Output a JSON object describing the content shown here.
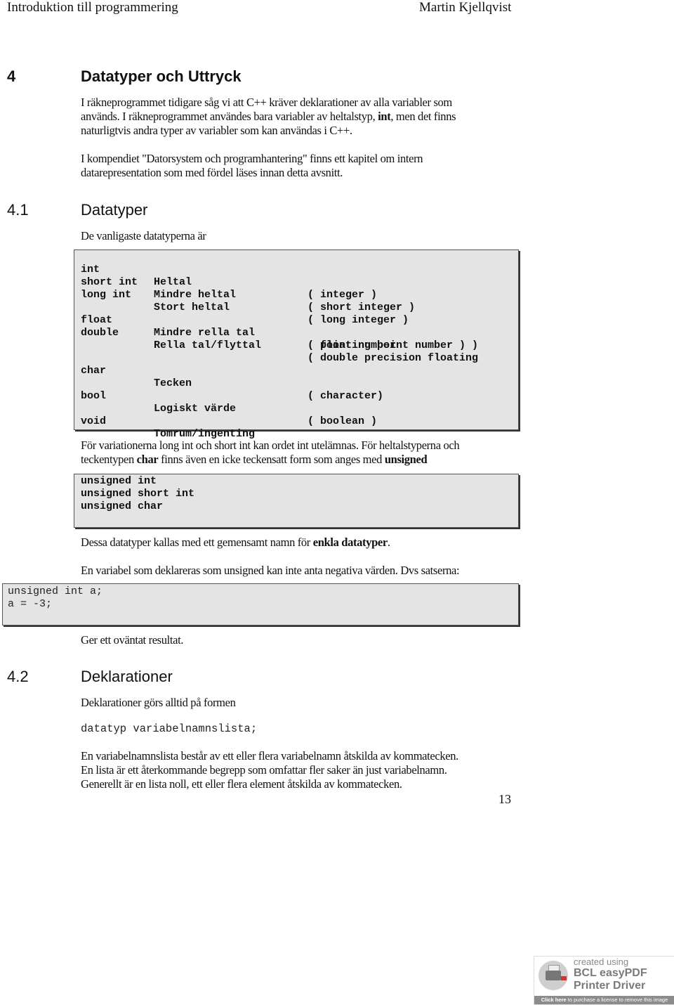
{
  "header": {
    "left": "Introduktion till programmering",
    "right": "Martin Kjellqvist"
  },
  "chapter": {
    "number": "4",
    "title": "Datatyper och Uttryck",
    "intro_lines": [
      [
        "I räkneprogrammet tidigare såg vi att C++ kräver deklarationer av alla variabler som"
      ],
      [
        "används. I räkneprogrammet användes bara  variabler av heltalstyp, ",
        "int",
        ", men det finns"
      ],
      [
        "naturligtvis andra typer av variabler som kan användas i C++."
      ]
    ],
    "note_lines": [
      "I kompendiet \"Datorsystem och programhantering\" finns ett kapitel om intern",
      "datarepresentation som med fördel läses innan detta avsnitt."
    ]
  },
  "section_4_1": {
    "number": "4.1",
    "title": "Datatyper",
    "lead": "De vanligaste datatyperna är",
    "types_table": [
      {
        "type": "int",
        "swedish": "Heltal",
        "english": "( integer )"
      },
      {
        "type": "short int",
        "swedish": "Mindre heltal",
        "english": "( short integer )"
      },
      {
        "type": "long int",
        "swedish": "Stort heltal",
        "english": "( long integer )"
      },
      {
        "type": "float",
        "swedish": "Mindre rella tal",
        "english": "( floating point number )"
      },
      {
        "type": "double",
        "swedish": "Rella tal/flyttal",
        "english": "( double precision floating"
      },
      {
        "type": "",
        "swedish": "",
        "english": "  point number            )"
      },
      {
        "type": "char",
        "swedish": "Tecken",
        "english": "( character)"
      },
      {
        "type": "bool",
        "swedish": "Logiskt värde",
        "english": "( boolean )"
      },
      {
        "type": "void",
        "swedish": "Tomrum/ingenting",
        "english": ""
      }
    ],
    "variations_line1": "För variationerna long int och short int kan ordet int utelämnas. För heltalstyperna och",
    "variations_line2_parts": [
      "teckentypen ",
      "char",
      " finns även en icke teckensatt form som anges med ",
      "unsigned"
    ],
    "unsigned_code": [
      "unsigned int",
      "unsigned short int",
      "unsigned char"
    ],
    "simple_types_parts": [
      "Dessa datatyper kallas med ett gemensamt namn för ",
      "enkla datatyper",
      "."
    ],
    "unsigned_note": "En variabel som deklareras som unsigned kan inte anta negativa värden. Dvs satserna:",
    "example_code": [
      "unsigned int a;",
      "a = -3;"
    ],
    "result_text": "Ger ett oväntat resultat."
  },
  "section_4_2": {
    "number": "4.2",
    "title": "Deklarationer",
    "lead": "Deklarationer görs alltid på formen",
    "syntax": "datatyp variabelnamnslista;",
    "body_lines": [
      "En variabelnamnslista består av ett eller flera variabelnamn åtskilda av kommatecken.",
      "En lista är ett återkommande begrepp som omfattar fler saker än just variabelnamn.",
      "Generellt är en lista noll, ett eller flera element åtskilda av kommatecken."
    ]
  },
  "page_number": "13",
  "watermark": {
    "line1": "created using",
    "line2": "BCL easyPDF",
    "line3": "Printer Driver",
    "bar_bold": "Click here",
    "bar_rest": " to purchase a license to remove this image",
    "icon": "printer-icon"
  }
}
